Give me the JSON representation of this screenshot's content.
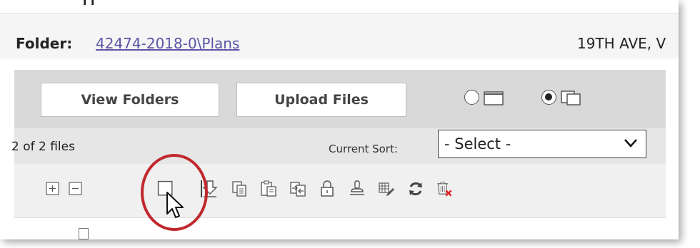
{
  "header": {
    "folder_label": "Folder:",
    "folder_path": "42474-2018-0\\Plans",
    "address_fragment": "19TH AVE, V"
  },
  "view_buttons": {
    "view_folders": "View Folders",
    "upload_files": "Upload Files"
  },
  "layout_options": [
    {
      "name": "single-pane",
      "selected": false
    },
    {
      "name": "split-pane",
      "selected": true
    }
  ],
  "list_info": {
    "file_count": "2 of 2 files",
    "sort_label": "Current Sort:",
    "sort_value": "- Select -"
  },
  "toolbar": {
    "icons": [
      "expand-icon",
      "collapse-icon",
      "select-all-checkbox",
      "download-icon",
      "copy-icon",
      "paste-icon",
      "move-icon",
      "lock-icon",
      "stamp-icon",
      "edit-properties-icon",
      "refresh-icon",
      "delete-icon"
    ]
  },
  "colors": {
    "link": "#5c55a6",
    "highlight_ring": "#c0282e",
    "delete_x": "#e0221e"
  }
}
